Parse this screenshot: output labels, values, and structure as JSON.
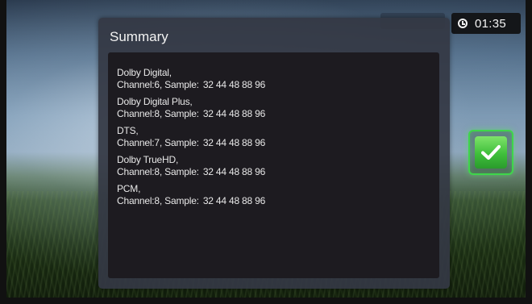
{
  "status": {
    "clock_time": "01:35"
  },
  "summary_dialog": {
    "title": "Summary",
    "entries": [
      {
        "codec": "Dolby Digital,",
        "channel": "Channel:6, Sample:",
        "samples": "32 44 48 88 96"
      },
      {
        "codec": "Dolby Digital Plus,",
        "channel": "Channel:8, Sample:",
        "samples": "32 44 48 88 96"
      },
      {
        "codec": "DTS,",
        "channel": "Channel:7, Sample:",
        "samples": "32 44 48 88 96"
      },
      {
        "codec": "Dolby TrueHD,",
        "channel": "Channel:8, Sample:",
        "samples": "32 44 48 88 96"
      },
      {
        "codec": "PCM,",
        "channel": "Channel:8, Sample:",
        "samples": "32 44 48 88 96"
      }
    ]
  },
  "confirm_button": {
    "icon": "checkmark-icon",
    "accent_color": "#3ed64a"
  },
  "colors": {
    "dialog_bg": "#343844",
    "content_bg": "#1d1b20",
    "text": "#e8e8e8",
    "clock_bg": "#141619"
  }
}
